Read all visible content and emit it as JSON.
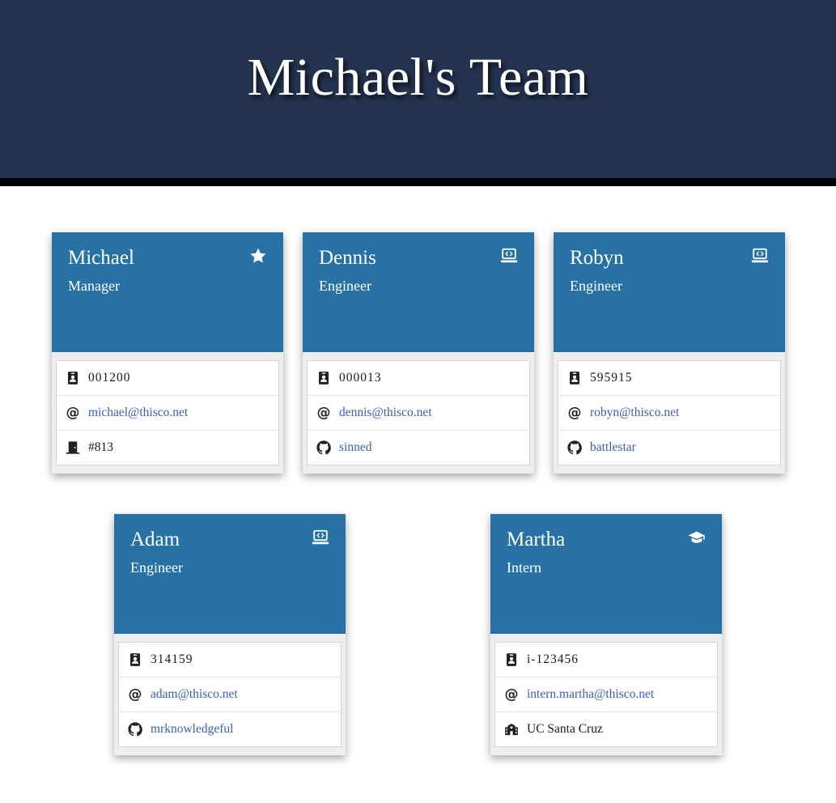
{
  "page": {
    "title": "Michael's Team"
  },
  "colors": {
    "header_bg": "#243450",
    "card_head": "#2771a4",
    "link": "#3a5fb0"
  },
  "cards": [
    {
      "name": "Michael",
      "role": "Manager",
      "role_icon": "star-icon",
      "id": "001200",
      "email": "michael@thisco.net",
      "extra_icon": "door-icon",
      "extra": "#813",
      "extra_is_link": false
    },
    {
      "name": "Dennis",
      "role": "Engineer",
      "role_icon": "laptop-code-icon",
      "id": "000013",
      "email": "dennis@thisco.net",
      "extra_icon": "github-icon",
      "extra": "sinned",
      "extra_is_link": true
    },
    {
      "name": "Robyn",
      "role": "Engineer",
      "role_icon": "laptop-code-icon",
      "id": "595915",
      "email": "robyn@thisco.net",
      "extra_icon": "github-icon",
      "extra": "battlestar",
      "extra_is_link": true
    },
    {
      "name": "Adam",
      "role": "Engineer",
      "role_icon": "laptop-code-icon",
      "id": "314159",
      "email": "adam@thisco.net",
      "extra_icon": "github-icon",
      "extra": "mrknowledgeful",
      "extra_is_link": true
    },
    {
      "name": "Martha",
      "role": "Intern",
      "role_icon": "graduation-cap-icon",
      "id": "i-123456",
      "email": "intern.martha@thisco.net",
      "extra_icon": "school-icon",
      "extra": "UC Santa Cruz",
      "extra_is_link": false
    }
  ]
}
